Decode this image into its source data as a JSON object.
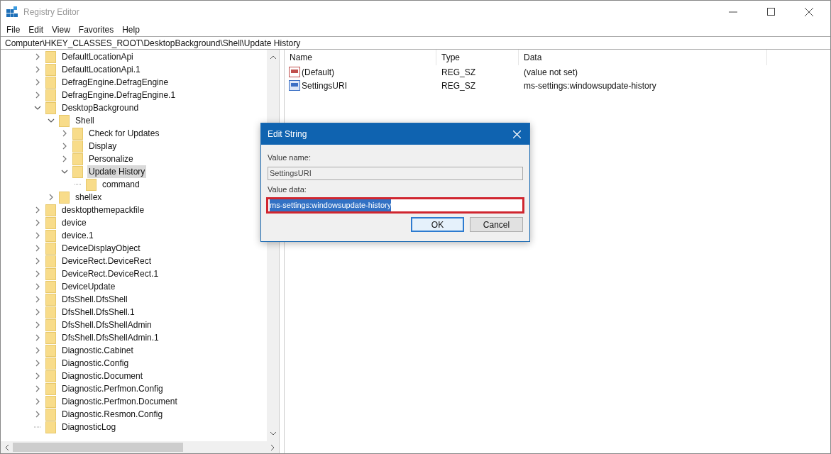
{
  "window": {
    "title": "Registry Editor"
  },
  "menu": [
    "File",
    "Edit",
    "View",
    "Favorites",
    "Help"
  ],
  "address": "Computer\\HKEY_CLASSES_ROOT\\DesktopBackground\\Shell\\Update History",
  "tree": [
    {
      "label": "DefaultLocationApi",
      "expandable": true,
      "expanded": false,
      "selected": false
    },
    {
      "label": "DefaultLocationApi.1",
      "expandable": true,
      "expanded": false,
      "selected": false
    },
    {
      "label": "DefragEngine.DefragEngine",
      "expandable": true,
      "expanded": false,
      "selected": false
    },
    {
      "label": "DefragEngine.DefragEngine.1",
      "expandable": true,
      "expanded": false,
      "selected": false
    },
    {
      "label": "DesktopBackground",
      "expandable": true,
      "expanded": true,
      "selected": false,
      "children": [
        {
          "label": "Shell",
          "expandable": true,
          "expanded": true,
          "selected": false,
          "children": [
            {
              "label": "Check for Updates",
              "expandable": true,
              "expanded": false,
              "selected": false
            },
            {
              "label": "Display",
              "expandable": true,
              "expanded": false,
              "selected": false
            },
            {
              "label": "Personalize",
              "expandable": true,
              "expanded": false,
              "selected": false
            },
            {
              "label": "Update History",
              "expandable": true,
              "expanded": true,
              "selected": true,
              "children": [
                {
                  "label": "command",
                  "expandable": false,
                  "selected": false
                }
              ]
            }
          ]
        },
        {
          "label": "shellex",
          "expandable": true,
          "expanded": false,
          "selected": false
        }
      ]
    },
    {
      "label": "desktopthemepackfile",
      "expandable": true,
      "expanded": false,
      "selected": false
    },
    {
      "label": "device",
      "expandable": true,
      "expanded": false,
      "selected": false
    },
    {
      "label": "device.1",
      "expandable": true,
      "expanded": false,
      "selected": false
    },
    {
      "label": "DeviceDisplayObject",
      "expandable": true,
      "expanded": false,
      "selected": false
    },
    {
      "label": "DeviceRect.DeviceRect",
      "expandable": true,
      "expanded": false,
      "selected": false
    },
    {
      "label": "DeviceRect.DeviceRect.1",
      "expandable": true,
      "expanded": false,
      "selected": false
    },
    {
      "label": "DeviceUpdate",
      "expandable": true,
      "expanded": false,
      "selected": false
    },
    {
      "label": "DfsShell.DfsShell",
      "expandable": true,
      "expanded": false,
      "selected": false
    },
    {
      "label": "DfsShell.DfsShell.1",
      "expandable": true,
      "expanded": false,
      "selected": false
    },
    {
      "label": "DfsShell.DfsShellAdmin",
      "expandable": true,
      "expanded": false,
      "selected": false
    },
    {
      "label": "DfsShell.DfsShellAdmin.1",
      "expandable": true,
      "expanded": false,
      "selected": false
    },
    {
      "label": "Diagnostic.Cabinet",
      "expandable": true,
      "expanded": false,
      "selected": false
    },
    {
      "label": "Diagnostic.Config",
      "expandable": true,
      "expanded": false,
      "selected": false
    },
    {
      "label": "Diagnostic.Document",
      "expandable": true,
      "expanded": false,
      "selected": false
    },
    {
      "label": "Diagnostic.Perfmon.Config",
      "expandable": true,
      "expanded": false,
      "selected": false
    },
    {
      "label": "Diagnostic.Perfmon.Document",
      "expandable": true,
      "expanded": false,
      "selected": false
    },
    {
      "label": "Diagnostic.Resmon.Config",
      "expandable": true,
      "expanded": false,
      "selected": false
    },
    {
      "label": "DiagnosticLog",
      "expandable": false,
      "selected": false
    }
  ],
  "values": {
    "columns": [
      "Name",
      "Type",
      "Data"
    ],
    "rows": [
      {
        "name": "(Default)",
        "type": "REG_SZ",
        "data": "(value not set)",
        "is_default": true
      },
      {
        "name": "SettingsURI",
        "type": "REG_SZ",
        "data": "ms-settings:windowsupdate-history",
        "is_default": false
      }
    ]
  },
  "dialog": {
    "title": "Edit String",
    "name_label": "Value name:",
    "name_value": "SettingsURI",
    "data_label": "Value data:",
    "data_value": "ms-settings:windowsupdate-history",
    "data_selected": true,
    "highlighted": true,
    "buttons": [
      {
        "label": "OK",
        "default": true
      },
      {
        "label": "Cancel",
        "default": false
      }
    ]
  }
}
